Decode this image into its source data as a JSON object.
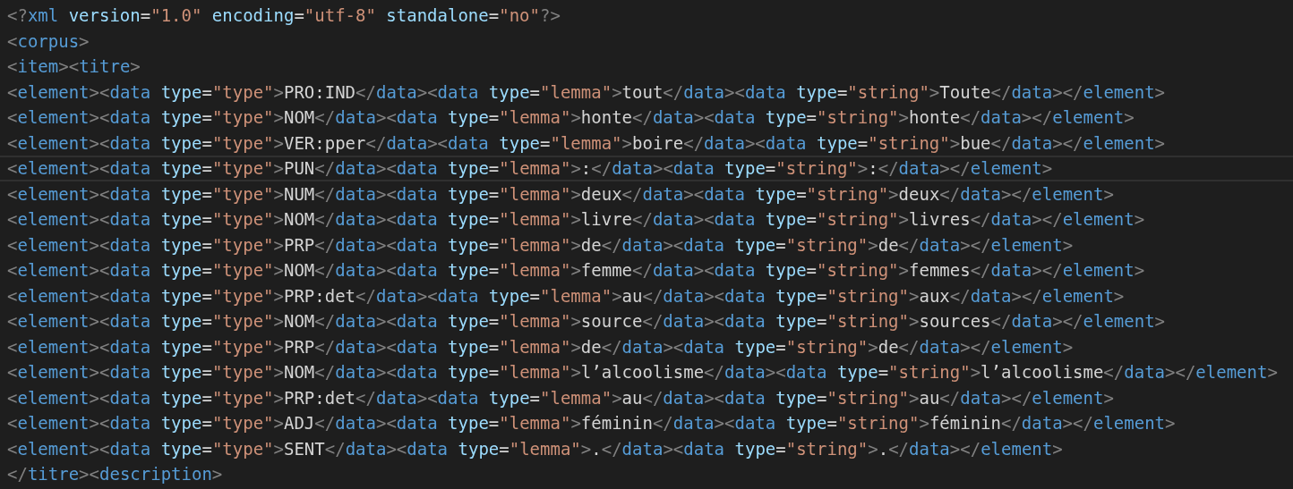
{
  "editor": {
    "lines": [
      {
        "text": "<?xml version=\"1.0\" encoding=\"utf-8\" standalone=\"no\"?>",
        "selected": false
      },
      {
        "text": "<corpus>",
        "selected": false
      },
      {
        "text": "<item><titre>",
        "selected": false
      },
      {
        "text": "<element><data type=\"type\">PRO:IND</data><data type=\"lemma\">tout</data><data type=\"string\">Toute</data></element>",
        "selected": false
      },
      {
        "text": "<element><data type=\"type\">NOM</data><data type=\"lemma\">honte</data><data type=\"string\">honte</data></element>",
        "selected": false
      },
      {
        "text": "<element><data type=\"type\">VER:pper</data><data type=\"lemma\">boire</data><data type=\"string\">bue</data></element>",
        "selected": false
      },
      {
        "text": "<element><data type=\"type\">PUN</data><data type=\"lemma\">:</data><data type=\"string\">:</data></element>",
        "selected": true
      },
      {
        "text": "<element><data type=\"type\">NUM</data><data type=\"lemma\">deux</data><data type=\"string\">deux</data></element>",
        "selected": false
      },
      {
        "text": "<element><data type=\"type\">NOM</data><data type=\"lemma\">livre</data><data type=\"string\">livres</data></element>",
        "selected": false
      },
      {
        "text": "<element><data type=\"type\">PRP</data><data type=\"lemma\">de</data><data type=\"string\">de</data></element>",
        "selected": false
      },
      {
        "text": "<element><data type=\"type\">NOM</data><data type=\"lemma\">femme</data><data type=\"string\">femmes</data></element>",
        "selected": false
      },
      {
        "text": "<element><data type=\"type\">PRP:det</data><data type=\"lemma\">au</data><data type=\"string\">aux</data></element>",
        "selected": false
      },
      {
        "text": "<element><data type=\"type\">NOM</data><data type=\"lemma\">source</data><data type=\"string\">sources</data></element>",
        "selected": false
      },
      {
        "text": "<element><data type=\"type\">PRP</data><data type=\"lemma\">de</data><data type=\"string\">de</data></element>",
        "selected": false
      },
      {
        "text": "<element><data type=\"type\">NOM</data><data type=\"lemma\">l’alcoolisme</data><data type=\"string\">l’alcoolisme</data></element>",
        "selected": false
      },
      {
        "text": "<element><data type=\"type\">PRP:det</data><data type=\"lemma\">au</data><data type=\"string\">au</data></element>",
        "selected": false
      },
      {
        "text": "<element><data type=\"type\">ADJ</data><data type=\"lemma\">féminin</data><data type=\"string\">féminin</data></element>",
        "selected": false
      },
      {
        "text": "<element><data type=\"type\">SENT</data><data type=\"lemma\">.</data><data type=\"string\">.</data></element>",
        "selected": false
      },
      {
        "text": "</titre><description>",
        "selected": false
      }
    ]
  }
}
